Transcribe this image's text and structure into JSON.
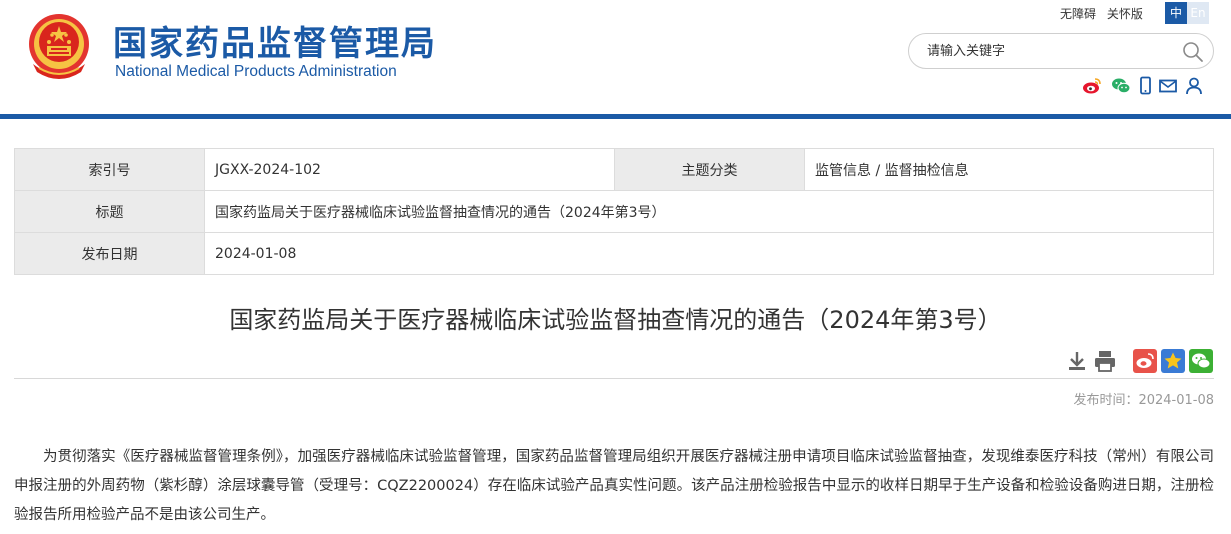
{
  "header": {
    "title_cn": "国家药品监督管理局",
    "title_en": "National Medical Products Administration",
    "links": [
      "无障碍",
      "关怀版"
    ],
    "lang_zh": "中",
    "lang_en": "En",
    "search_placeholder": "请输入关键字",
    "socials": [
      "weibo-icon",
      "wechat-icon",
      "mobile-icon",
      "mail-icon",
      "user-icon"
    ],
    "brand_color": "#1b5aa6"
  },
  "info": {
    "index_label": "索引号",
    "index_value": "JGXX-2024-102",
    "category_label": "主题分类",
    "category_value": "监管信息 / 监督抽检信息",
    "title_label": "标题",
    "title_value": "国家药监局关于医疗器械临床试验监督抽查情况的通告（2024年第3号）",
    "date_label": "发布日期",
    "date_value": "2024-01-08"
  },
  "article": {
    "title": "国家药监局关于医疗器械临床试验监督抽查情况的通告（2024年第3号）",
    "tools": [
      "download-icon",
      "print-icon",
      "weibo-share-icon",
      "favorite-icon",
      "wechat-share-icon"
    ],
    "pub_time": "发布时间：2024-01-08",
    "body": "为贯彻落实《医疗器械监督管理条例》，加强医疗器械临床试验监督管理，国家药品监督管理局组织开展医疗器械注册申请项目临床试验监督抽查，发现维泰医疗科技（常州）有限公司申报注册的外周药物（紫杉醇）涂层球囊导管（受理号：CQZ2200024）存在临床试验产品真实性问题。该产品注册检验报告中显示的收样日期早于生产设备和检验设备购进日期，注册检验报告所用检验产品不是由该公司生产。"
  }
}
